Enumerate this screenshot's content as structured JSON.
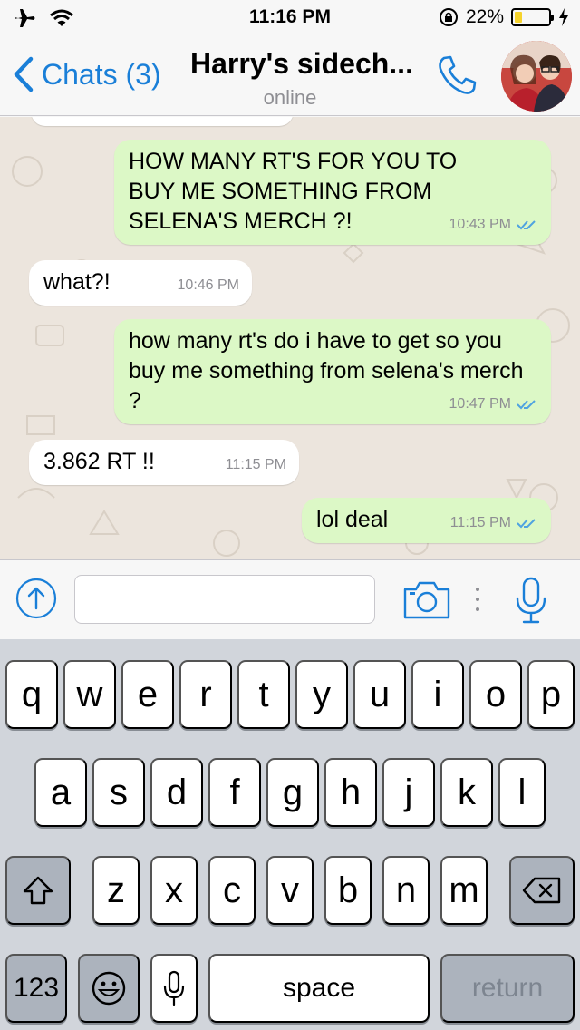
{
  "status_bar": {
    "time": "11:16 PM",
    "battery": "22%",
    "battery_level": 0.22,
    "icons": [
      "airplane-icon",
      "wifi-icon",
      "rotation-lock-icon",
      "battery-icon",
      "charging-bolt-icon"
    ]
  },
  "header": {
    "back_label": "Chats (3)",
    "title": "Harry's sidech...",
    "subtitle": "online",
    "accent_color": "#1a7fd8"
  },
  "messages": [
    {
      "direction": "out",
      "text": "HOW MANY RT'S FOR YOU TO BUY ME SOMETHING FROM SELENA'S MERCH ?!",
      "time": "10:43 PM",
      "read": true
    },
    {
      "direction": "in",
      "text": "what?!",
      "time": "10:46 PM"
    },
    {
      "direction": "out",
      "text": "how many rt's do i have to get so you buy me something from selena's merch ?",
      "time": "10:47 PM",
      "read": true
    },
    {
      "direction": "in",
      "text": "3.862 RT !!",
      "time": "11:15 PM"
    },
    {
      "direction": "out",
      "text": "lol deal",
      "time": "11:15 PM",
      "read": true
    }
  ],
  "input": {
    "value": "",
    "placeholder": ""
  },
  "keyboard": {
    "row1": [
      "q",
      "w",
      "e",
      "r",
      "t",
      "y",
      "u",
      "i",
      "o",
      "p"
    ],
    "row2": [
      "a",
      "s",
      "d",
      "f",
      "g",
      "h",
      "j",
      "k",
      "l"
    ],
    "row3": [
      "z",
      "x",
      "c",
      "v",
      "b",
      "n",
      "m"
    ],
    "numbers_label": "123",
    "space_label": "space",
    "return_label": "return"
  },
  "colors": {
    "outgoing_bubble": "#dcf8c6",
    "incoming_bubble": "#ffffff",
    "chat_background": "#ece5dd",
    "read_ticks": "#4fa3e0"
  }
}
